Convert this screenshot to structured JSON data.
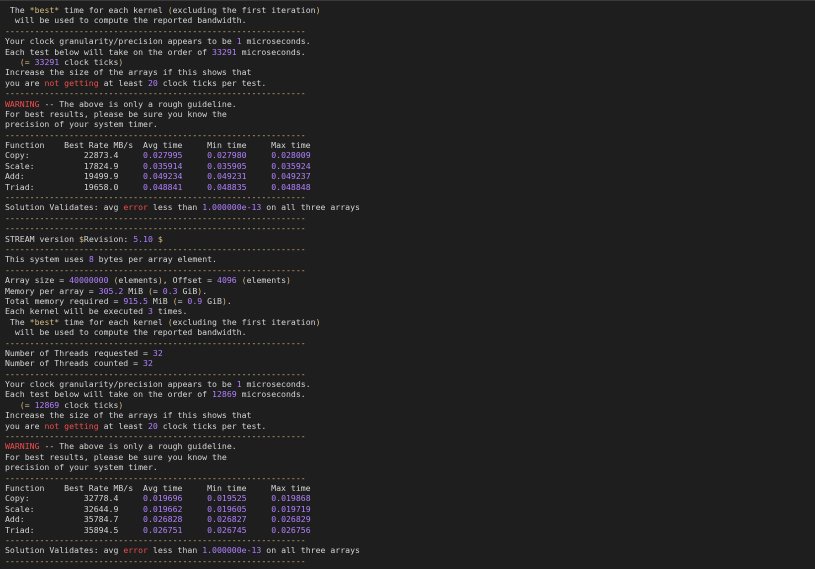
{
  "colors": {
    "background": "#1e1e1e",
    "text": "#d4d4d4",
    "number": "#b180ff",
    "red": "#f14c4c",
    "yellow": "#d7ba7d"
  },
  "lines": [
    [
      [
        " The ",
        ""
      ],
      [
        "*best*",
        "y"
      ],
      [
        " time for each kernel ",
        ""
      ],
      [
        "(",
        "y"
      ],
      [
        "excluding the first iteration",
        ""
      ],
      [
        ")",
        "y"
      ]
    ],
    [
      [
        "  will be used to compute the reported bandwidth.",
        ""
      ]
    ],
    [
      [
        "-------------------------------------------------------------",
        "y"
      ]
    ],
    [
      [
        "Your clock granularity/precision appears to be ",
        ""
      ],
      [
        "1",
        "n"
      ],
      [
        " microseconds.",
        ""
      ]
    ],
    [
      [
        "Each test below will take on the order of ",
        ""
      ],
      [
        "33291",
        "n"
      ],
      [
        " microseconds.",
        ""
      ]
    ],
    [
      [
        "   ",
        ""
      ],
      [
        "(",
        "y"
      ],
      [
        "= ",
        "y"
      ],
      [
        "33291",
        "n"
      ],
      [
        " clock ticks",
        ""
      ],
      [
        ")",
        "y"
      ]
    ],
    [
      [
        "Increase the size of the arrays if this shows that",
        ""
      ]
    ],
    [
      [
        "you are ",
        ""
      ],
      [
        "not getting",
        "r"
      ],
      [
        " at least ",
        ""
      ],
      [
        "20",
        "n"
      ],
      [
        " clock ticks per test.",
        ""
      ]
    ],
    [
      [
        "-------------------------------------------------------------",
        "y"
      ]
    ],
    [
      [
        "WARNING",
        "r"
      ],
      [
        " -- The above is only a rough guideline.",
        ""
      ]
    ],
    [
      [
        "For best results, please be sure you know the",
        ""
      ]
    ],
    [
      [
        "precision of your system timer.",
        ""
      ]
    ],
    [
      [
        "-------------------------------------------------------------",
        "y"
      ]
    ],
    [
      [
        "Function    Best Rate MB/s  Avg time     Min time     Max time",
        ""
      ]
    ],
    [
      [
        "Copy:",
        ""
      ],
      [
        "           22873.4     ",
        ""
      ],
      [
        "0.027995",
        "n"
      ],
      [
        "     ",
        ""
      ],
      [
        "0.027980",
        "n"
      ],
      [
        "     ",
        ""
      ],
      [
        "0.028009",
        "n"
      ]
    ],
    [
      [
        "Scale:",
        ""
      ],
      [
        "          17824.9     ",
        ""
      ],
      [
        "0.035914",
        "n"
      ],
      [
        "     ",
        ""
      ],
      [
        "0.035905",
        "n"
      ],
      [
        "     ",
        ""
      ],
      [
        "0.035924",
        "n"
      ]
    ],
    [
      [
        "Add:",
        ""
      ],
      [
        "            19499.9     ",
        ""
      ],
      [
        "0.049234",
        "n"
      ],
      [
        "     ",
        ""
      ],
      [
        "0.049231",
        "n"
      ],
      [
        "     ",
        ""
      ],
      [
        "0.049237",
        "n"
      ]
    ],
    [
      [
        "Triad:",
        ""
      ],
      [
        "          19658.0     ",
        ""
      ],
      [
        "0.048841",
        "n"
      ],
      [
        "     ",
        ""
      ],
      [
        "0.048835",
        "n"
      ],
      [
        "     ",
        ""
      ],
      [
        "0.048848",
        "n"
      ]
    ],
    [
      [
        "-------------------------------------------------------------",
        "y"
      ]
    ],
    [
      [
        "Solution Validates: avg ",
        ""
      ],
      [
        "error",
        "r"
      ],
      [
        " less than ",
        ""
      ],
      [
        "1.000000e-13",
        "n"
      ],
      [
        " on all three arrays",
        ""
      ]
    ],
    [
      [
        "-------------------------------------------------------------",
        "y"
      ]
    ],
    [
      [
        "-------------------------------------------------------------",
        "y"
      ]
    ],
    [
      [
        "STREAM version ",
        ""
      ],
      [
        "$",
        "y"
      ],
      [
        "Revision: ",
        ""
      ],
      [
        "5.10",
        "n"
      ],
      [
        " ",
        ""
      ],
      [
        "$",
        "y"
      ]
    ],
    [
      [
        "-------------------------------------------------------------",
        "y"
      ]
    ],
    [
      [
        "This system uses ",
        ""
      ],
      [
        "8",
        "n"
      ],
      [
        " bytes per array element.",
        ""
      ]
    ],
    [
      [
        "-------------------------------------------------------------",
        "y"
      ]
    ],
    [
      [
        "Array size = ",
        ""
      ],
      [
        "40000000",
        "n"
      ],
      [
        " ",
        ""
      ],
      [
        "(",
        "y"
      ],
      [
        "elements",
        ""
      ],
      [
        ")",
        "y"
      ],
      [
        ", Offset = ",
        ""
      ],
      [
        "4096",
        "n"
      ],
      [
        " ",
        ""
      ],
      [
        "(",
        "y"
      ],
      [
        "elements",
        ""
      ],
      [
        ")",
        "y"
      ]
    ],
    [
      [
        "Memory per array = ",
        ""
      ],
      [
        "305.2",
        "n"
      ],
      [
        " MiB ",
        ""
      ],
      [
        "(",
        "y"
      ],
      [
        "= ",
        ""
      ],
      [
        "0.3",
        "n"
      ],
      [
        " GiB",
        ""
      ],
      [
        ")",
        "y"
      ],
      [
        ".",
        ""
      ]
    ],
    [
      [
        "Total memory required = ",
        ""
      ],
      [
        "915.5",
        "n"
      ],
      [
        " MiB ",
        ""
      ],
      [
        "(",
        "y"
      ],
      [
        "= ",
        ""
      ],
      [
        "0.9",
        "n"
      ],
      [
        " GiB",
        ""
      ],
      [
        ")",
        "y"
      ],
      [
        ".",
        ""
      ]
    ],
    [
      [
        "Each kernel will be executed ",
        ""
      ],
      [
        "3",
        "n"
      ],
      [
        " times.",
        ""
      ]
    ],
    [
      [
        " The ",
        ""
      ],
      [
        "*best*",
        "y"
      ],
      [
        " time for each kernel ",
        ""
      ],
      [
        "(",
        "y"
      ],
      [
        "excluding the first iteration",
        ""
      ],
      [
        ")",
        "y"
      ]
    ],
    [
      [
        "  will be used to compute the reported bandwidth.",
        ""
      ]
    ],
    [
      [
        "-------------------------------------------------------------",
        "y"
      ]
    ],
    [
      [
        "Number of Threads requested = ",
        ""
      ],
      [
        "32",
        "n"
      ]
    ],
    [
      [
        "Number of Threads counted = ",
        ""
      ],
      [
        "32",
        "n"
      ]
    ],
    [
      [
        "-------------------------------------------------------------",
        "y"
      ]
    ],
    [
      [
        "Your clock granularity/precision appears to be ",
        ""
      ],
      [
        "1",
        "n"
      ],
      [
        " microseconds.",
        ""
      ]
    ],
    [
      [
        "Each test below will take on the order of ",
        ""
      ],
      [
        "12869",
        "n"
      ],
      [
        " microseconds.",
        ""
      ]
    ],
    [
      [
        "   ",
        ""
      ],
      [
        "(",
        "y"
      ],
      [
        "= ",
        "y"
      ],
      [
        "12869",
        "n"
      ],
      [
        " clock ticks",
        ""
      ],
      [
        ")",
        "y"
      ]
    ],
    [
      [
        "Increase the size of the arrays if this shows that",
        ""
      ]
    ],
    [
      [
        "you are ",
        ""
      ],
      [
        "not getting",
        "r"
      ],
      [
        " at least ",
        ""
      ],
      [
        "20",
        "n"
      ],
      [
        " clock ticks per test.",
        ""
      ]
    ],
    [
      [
        "-------------------------------------------------------------",
        "y"
      ]
    ],
    [
      [
        "WARNING",
        "r"
      ],
      [
        " -- The above is only a rough guideline.",
        ""
      ]
    ],
    [
      [
        "For best results, please be sure you know the",
        ""
      ]
    ],
    [
      [
        "precision of your system timer.",
        ""
      ]
    ],
    [
      [
        "-------------------------------------------------------------",
        "y"
      ]
    ],
    [
      [
        "Function    Best Rate MB/s  Avg time     Min time     Max time",
        ""
      ]
    ],
    [
      [
        "Copy:",
        ""
      ],
      [
        "           32778.4     ",
        ""
      ],
      [
        "0.019696",
        "n"
      ],
      [
        "     ",
        ""
      ],
      [
        "0.019525",
        "n"
      ],
      [
        "     ",
        ""
      ],
      [
        "0.019868",
        "n"
      ]
    ],
    [
      [
        "Scale:",
        ""
      ],
      [
        "          32644.9     ",
        ""
      ],
      [
        "0.019662",
        "n"
      ],
      [
        "     ",
        ""
      ],
      [
        "0.019605",
        "n"
      ],
      [
        "     ",
        ""
      ],
      [
        "0.019719",
        "n"
      ]
    ],
    [
      [
        "Add:",
        ""
      ],
      [
        "            35784.7     ",
        ""
      ],
      [
        "0.026828",
        "n"
      ],
      [
        "     ",
        ""
      ],
      [
        "0.026827",
        "n"
      ],
      [
        "     ",
        ""
      ],
      [
        "0.026829",
        "n"
      ]
    ],
    [
      [
        "Triad:",
        ""
      ],
      [
        "          35894.5     ",
        ""
      ],
      [
        "0.026751",
        "n"
      ],
      [
        "     ",
        ""
      ],
      [
        "0.026745",
        "n"
      ],
      [
        "     ",
        ""
      ],
      [
        "0.026756",
        "n"
      ]
    ],
    [
      [
        "-------------------------------------------------------------",
        "y"
      ]
    ],
    [
      [
        "Solution Validates: avg ",
        ""
      ],
      [
        "error",
        "r"
      ],
      [
        " less than ",
        ""
      ],
      [
        "1.000000e-13",
        "n"
      ],
      [
        " on all three arrays",
        ""
      ]
    ],
    [
      [
        "-------------------------------------------------------------",
        "y"
      ]
    ]
  ]
}
